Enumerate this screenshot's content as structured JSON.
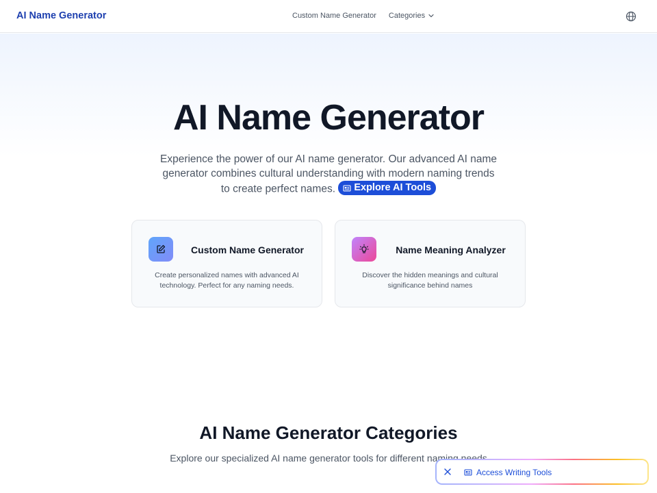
{
  "nav": {
    "brand": "AI Name Generator",
    "links": [
      {
        "label": "Custom Name Generator"
      },
      {
        "label": "Categories"
      }
    ]
  },
  "hero": {
    "title": "AI Name Generator",
    "description": "Experience the power of our AI name generator. Our advanced AI name generator combines cultural understanding with modern naming trends to create perfect names.",
    "explore_label": "Explore AI Tools"
  },
  "cards": [
    {
      "title": "Custom Name Generator",
      "description": "Create personalized names with advanced AI technology. Perfect for any naming needs.",
      "icon": "edit-icon"
    },
    {
      "title": "Name Meaning Analyzer",
      "description": "Discover the hidden meanings and cultural significance behind names",
      "icon": "lightbulb-icon"
    }
  ],
  "categories": {
    "title": "AI Name Generator Categories",
    "description": "Explore our specialized AI name generator tools for different naming needs"
  },
  "writing_tools": {
    "label": "Access Writing Tools"
  },
  "colors": {
    "brand": "#1e40af",
    "accent": "#1d4ed8",
    "text": "#111827",
    "muted": "#4b5563"
  }
}
